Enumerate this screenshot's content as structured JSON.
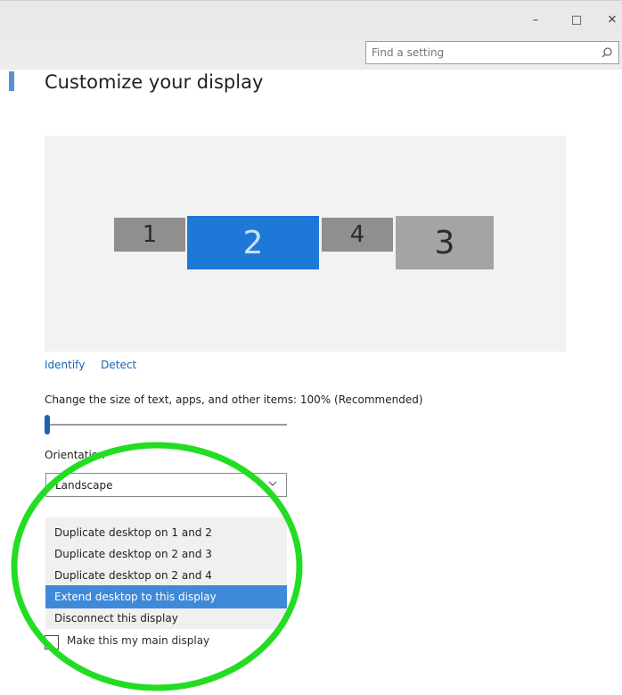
{
  "window": {
    "minimize_glyph": "–",
    "maximize_glyph": "□",
    "close_glyph": "✕"
  },
  "search": {
    "placeholder": "Find a setting",
    "icon": "search-icon"
  },
  "page": {
    "title": "Customize your display"
  },
  "displays": [
    {
      "label": "1",
      "state": "inactive"
    },
    {
      "label": "2",
      "state": "selected"
    },
    {
      "label": "4",
      "state": "inactive"
    },
    {
      "label": "3",
      "state": "inactive"
    }
  ],
  "links": {
    "identify": "Identify",
    "detect": "Detect"
  },
  "scale": {
    "label": "Change the size of text, apps, and other items: 100% (Recommended)",
    "slider_value_fraction": 0.0
  },
  "orientation": {
    "label": "Orientation",
    "value": "Landscape"
  },
  "multiple_displays": {
    "options": [
      "Duplicate desktop on 1 and 2",
      "Duplicate desktop on 2 and 3",
      "Duplicate desktop on 2 and 4",
      "Extend desktop to this display",
      "Disconnect this display"
    ],
    "selected": "Extend desktop to this display"
  },
  "main_display": {
    "label": "Make this my main display",
    "checked": false
  },
  "colors": {
    "accent": "#1e78d7",
    "link": "#1a64b0",
    "selected_option": "#3f8ad8",
    "annotation_ellipse": "#22dd22"
  }
}
